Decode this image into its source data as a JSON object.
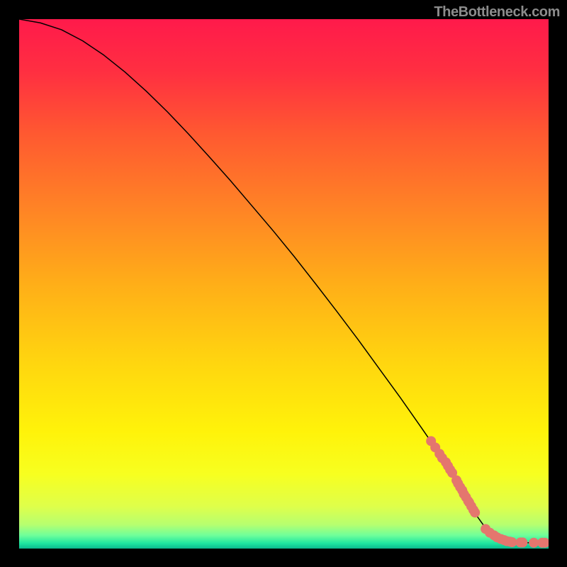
{
  "attribution": "TheBottleneck.com",
  "chart_data": {
    "type": "line",
    "title": "",
    "xlabel": "",
    "ylabel": "",
    "xlim": [
      0,
      100
    ],
    "ylim": [
      0,
      100
    ],
    "background_gradient_stops": [
      {
        "t": 0.0,
        "color": "#ff1a4b"
      },
      {
        "t": 0.1,
        "color": "#ff2f41"
      },
      {
        "t": 0.22,
        "color": "#ff5a30"
      },
      {
        "t": 0.35,
        "color": "#ff8126"
      },
      {
        "t": 0.5,
        "color": "#ffae18"
      },
      {
        "t": 0.65,
        "color": "#ffd60f"
      },
      {
        "t": 0.78,
        "color": "#fff30a"
      },
      {
        "t": 0.86,
        "color": "#f7ff20"
      },
      {
        "t": 0.92,
        "color": "#dfff4a"
      },
      {
        "t": 0.955,
        "color": "#b6ff70"
      },
      {
        "t": 0.975,
        "color": "#6fff9a"
      },
      {
        "t": 0.99,
        "color": "#1fe6a0"
      },
      {
        "t": 1.0,
        "color": "#0ab98e"
      }
    ],
    "series": [
      {
        "name": "curve",
        "kind": "line",
        "color": "#000000",
        "stroke_width": 1.5,
        "x": [
          0,
          4,
          8,
          12,
          16,
          20,
          24,
          28,
          32,
          36,
          40,
          44,
          48,
          52,
          56,
          60,
          64,
          68,
          72,
          76,
          80,
          82.5,
          84.5,
          86,
          88,
          90,
          93,
          96,
          100
        ],
        "y": [
          100,
          99.3,
          98.0,
          95.9,
          93.2,
          90.0,
          86.4,
          82.5,
          78.3,
          73.9,
          69.4,
          64.7,
          60.0,
          55.1,
          50.0,
          44.8,
          39.5,
          34.0,
          28.5,
          22.8,
          17.0,
          13.3,
          9.5,
          6.8,
          4.0,
          2.2,
          1.3,
          1.1,
          1.1
        ]
      },
      {
        "name": "highlighted-points-upper",
        "kind": "scatter",
        "color": "#e4766e",
        "radius": 7,
        "x": [
          77.8,
          78.6,
          79.4,
          79.9,
          80.6,
          81.0,
          81.4,
          81.8
        ],
        "y": [
          20.3,
          19.1,
          17.9,
          17.1,
          16.3,
          15.6,
          14.9,
          14.3
        ]
      },
      {
        "name": "highlighted-points-mid",
        "kind": "scatter",
        "color": "#e4766e",
        "radius": 7,
        "x": [
          82.6,
          82.9,
          83.3,
          83.7,
          84.0,
          84.4,
          84.8,
          85.0,
          85.4,
          85.8,
          86.1
        ],
        "y": [
          12.9,
          12.3,
          11.6,
          11.0,
          10.3,
          9.7,
          9.0,
          8.7,
          8.0,
          7.3,
          6.8
        ]
      },
      {
        "name": "highlighted-points-bottom",
        "kind": "scatter",
        "color": "#e4766e",
        "radius": 7,
        "x": [
          88.1,
          88.9,
          89.7,
          90.3,
          91.0,
          91.6,
          92.1,
          92.7,
          93.1,
          94.7,
          95.1,
          97.2,
          98.8,
          99.3
        ],
        "y": [
          3.7,
          3.0,
          2.5,
          2.1,
          1.8,
          1.6,
          1.4,
          1.3,
          1.2,
          1.15,
          1.15,
          1.1,
          1.1,
          1.1
        ]
      }
    ]
  }
}
